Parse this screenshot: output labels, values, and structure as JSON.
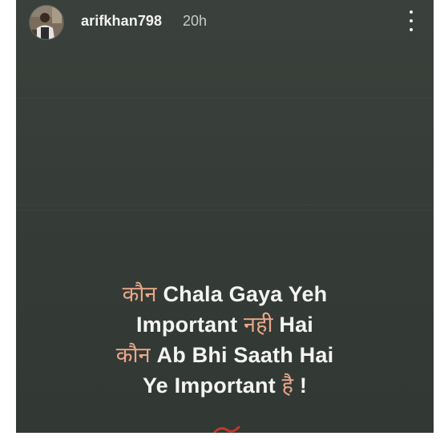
{
  "story": {
    "username": "arifkhan798",
    "time": "20h",
    "lines": [
      {
        "accent": "कौन",
        "text": " Chala Gaya Yeh"
      },
      {
        "text": "Important ",
        "accent": "नही",
        "tail": " Hai"
      },
      {
        "accent": "कौन",
        "text": " Ab Bhi Saath Hai"
      },
      {
        "text": "Ye Important ",
        "accent": "है",
        "tail": " !"
      }
    ]
  },
  "colors": {
    "background": "#373e39",
    "text": "#f4f4f4",
    "accent": "#e9a889",
    "decoration": "#c0392b"
  },
  "icons": {
    "more": "more-vertical-icon"
  }
}
